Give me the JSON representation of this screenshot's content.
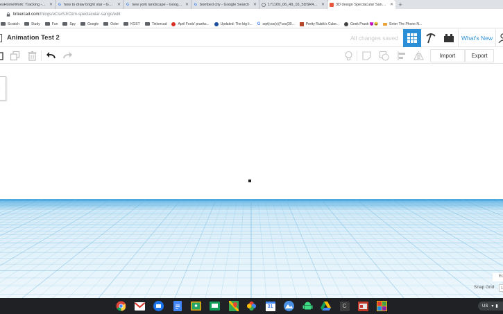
{
  "browser": {
    "tabs": [
      {
        "title": "esHomeWork: Tracking - Goo",
        "favicon": "document-icon"
      },
      {
        "title": "how to draw bright star - Google",
        "favicon": "google-icon"
      },
      {
        "title": "new york landscape - Google Sea",
        "favicon": "google-icon"
      },
      {
        "title": "bombed city - Google Search",
        "favicon": "google-icon"
      },
      {
        "title": "171109_06_49_10_5DSR4201.Di",
        "favicon": "globe-icon"
      },
      {
        "title": "3D design Spectacular Sango | Tin",
        "favicon": "tinkercad-icon",
        "active": true
      }
    ],
    "new_tab_label": "+",
    "url_host": "tinkercad.com",
    "url_path": "/things/eCsvSJrOzm-spectacular-sango/edit",
    "bookmarks": [
      {
        "label": "Scratch",
        "icon": "folder-icon"
      },
      {
        "label": "Study",
        "icon": "folder-icon"
      },
      {
        "label": "Fun",
        "icon": "folder-icon"
      },
      {
        "label": "Spy",
        "icon": "folder-icon"
      },
      {
        "label": "Google",
        "icon": "folder-icon"
      },
      {
        "label": "Osler",
        "icon": "folder-icon"
      },
      {
        "label": "KOST",
        "icon": "folder-icon"
      },
      {
        "label": "Tinkercad",
        "icon": "folder-icon"
      },
      {
        "label": "April Fools' pranks...",
        "icon": "red-circle-icon"
      },
      {
        "label": "Updated: The big li...",
        "icon": "blue-circle-icon"
      },
      {
        "label": "sqrt(cos(x))*cos(30...",
        "icon": "google-icon"
      },
      {
        "label": "Pretty Rubik's Cube...",
        "icon": "cube-icon"
      },
      {
        "label": "Geek Prank 😈😂",
        "icon": "geek-icon"
      },
      {
        "label": "Enter The Phone N...",
        "icon": "phone-icon"
      }
    ]
  },
  "tinkercad": {
    "design_title": "Animation Test 2",
    "save_status": "All changes saved",
    "whats_new": "What's New",
    "import_label": "Import",
    "export_label": "Export",
    "viewcube_glyph": "‹",
    "edit_grid_label": "Ed",
    "snap_grid_label": "Snap Grid",
    "snap_value": "1"
  },
  "shelf": {
    "apps": [
      "chrome-icon",
      "gmail-icon",
      "files-icon",
      "docs-icon",
      "classroom-icon",
      "slides-icon",
      "maps-icon",
      "photos-icon",
      "calendar-icon",
      "earth-icon",
      "drive-icon",
      "android-icon",
      "c-app-icon",
      "news-icon",
      "game-icon"
    ],
    "calendar_day": "31",
    "c_app_letter": "C",
    "locale": "US"
  },
  "colors": {
    "tinkercad_blue": "#2a8fd6",
    "tab_strip": "#dee1e6",
    "shelf": "#202124",
    "grid_line": "#6fb7e0"
  }
}
